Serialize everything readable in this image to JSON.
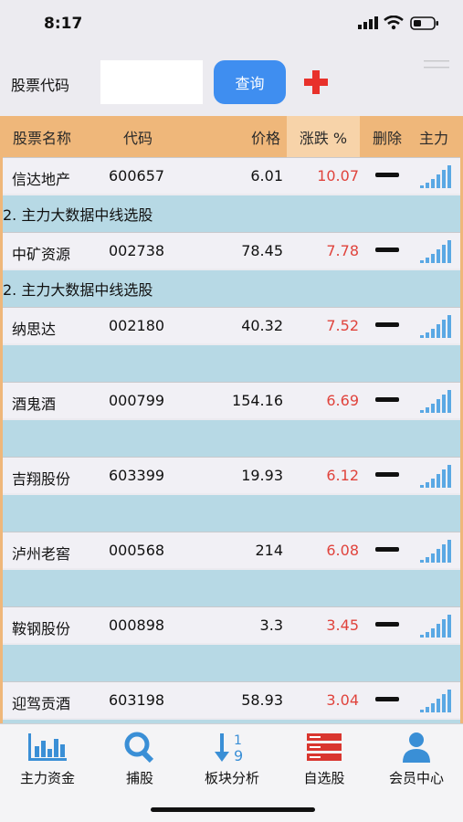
{
  "status": {
    "time": "8:17"
  },
  "search": {
    "label": "股票代码",
    "value": "",
    "button": "查询"
  },
  "table": {
    "headers": {
      "name": "股票名称",
      "code": "代码",
      "price": "价格",
      "change": "涨跌 %",
      "delete": "删除",
      "main": "主力"
    },
    "rows": [
      {
        "name": "信达地产",
        "code": "600657",
        "price": "6.01",
        "change": "10.07",
        "note": "2. 主力大数据中线选股"
      },
      {
        "name": "中矿资源",
        "code": "002738",
        "price": "78.45",
        "change": "7.78",
        "note": "2. 主力大数据中线选股"
      },
      {
        "name": "纳思达",
        "code": "002180",
        "price": "40.32",
        "change": "7.52",
        "note": ""
      },
      {
        "name": "酒鬼酒",
        "code": "000799",
        "price": "154.16",
        "change": "6.69",
        "note": ""
      },
      {
        "name": "吉翔股份",
        "code": "603399",
        "price": "19.93",
        "change": "6.12",
        "note": ""
      },
      {
        "name": "泸州老窖",
        "code": "000568",
        "price": "214",
        "change": "6.08",
        "note": ""
      },
      {
        "name": "鞍钢股份",
        "code": "000898",
        "price": "3.3",
        "change": "3.45",
        "note": ""
      },
      {
        "name": "迎驾贡酒",
        "code": "603198",
        "price": "58.93",
        "change": "3.04",
        "note": ""
      }
    ]
  },
  "tabs": [
    {
      "label": "主力资金",
      "icon": "bar-chart-icon"
    },
    {
      "label": "捕股",
      "icon": "search-icon"
    },
    {
      "label": "板块分析",
      "icon": "sort-icon"
    },
    {
      "label": "自选股",
      "icon": "server-icon"
    },
    {
      "label": "会员中心",
      "icon": "user-icon"
    }
  ],
  "colors": {
    "accent": "#3f8ef0",
    "header": "#efb77a",
    "rise": "#e0433c",
    "note_band": "#b7d9e5",
    "add": "#e8312b"
  }
}
